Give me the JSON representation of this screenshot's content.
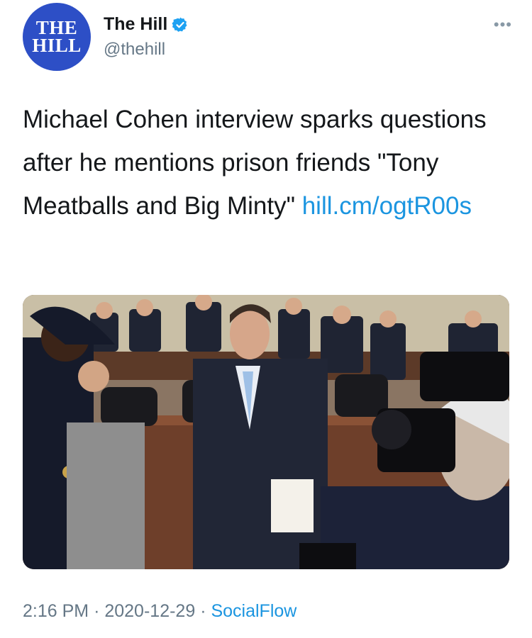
{
  "account": {
    "avatar_line1": "THE",
    "avatar_line2": "HILL",
    "display_name": "The Hill",
    "handle": "@thehill",
    "verified_icon": "verified-badge-icon",
    "brand_color": "#2d4fc6"
  },
  "menu": {
    "more_label": "•••"
  },
  "tweet": {
    "text": "Michael Cohen interview sparks questions after he mentions prison friends \"Tony Meatballs and Big Minty\" ",
    "link_text": "hill.cm/ogtR00s",
    "link_color": "#1b95e0"
  },
  "media": {
    "type": "photo"
  },
  "meta": {
    "time": "2:16 PM",
    "separator": "·",
    "date": "2020-12-29",
    "source": "SocialFlow"
  }
}
